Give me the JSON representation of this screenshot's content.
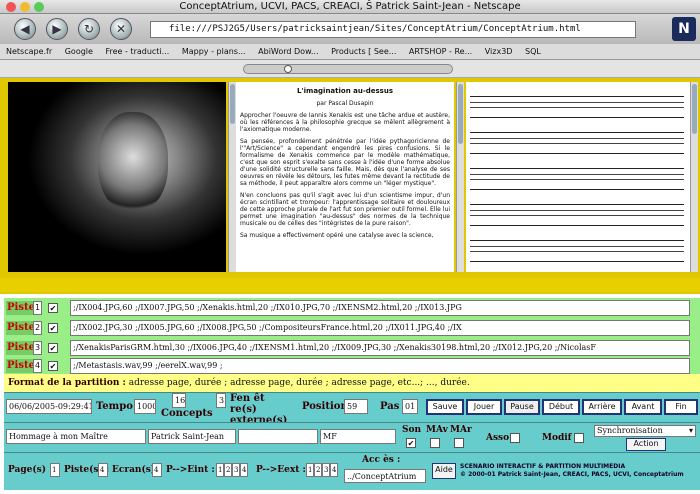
{
  "window": {
    "title": "ConceptAtrium, UCVI, PACS, CREACI, Š Patrick Saint-Jean - Netscape"
  },
  "toolbar": {
    "url": "file:///PSJ2G5/Users/patricksaintjean/Sites/ConceptAtrium/ConceptAtrium.html",
    "nav_icons": [
      "back-icon",
      "forward-icon",
      "reload-icon",
      "stop-icon"
    ],
    "logo": "N"
  },
  "bookmarks": [
    "Netscape.fr",
    "Google",
    "Free - traducti...",
    "Mappy - plans...",
    "AbiWord Dow...",
    "Products [ See...",
    "ARTSHOP - Re...",
    "Vizx3D",
    "SQL"
  ],
  "article": {
    "title": "L'imagination au-dessus",
    "author": "par Pascal Dusapin",
    "paragraphs": [
      "Approcher l'oeuvre de Iannis Xenakis est une tâche ardue et austère, où les références à la philosophie grecque se mêlent allègrement à l'axiomatique moderne.",
      "Sa pensée, profondément pénétrée par l'idée pythagoricienne de l'\"Art/Science\" a cependant engendré les pires confusions. Si le formalisme de Xenakis commence par le modèle mathématique, c'est que son esprit s'exalte sans cesse à l'idée d'une forme absolue d'une solidité structurelle sans faille. Mais, dès que l'analyse de ses oeuvres en révèle les détours, les futes même devant la rectitude de sa méthode, il peut apparaître alors comme un \"léger mystique\".",
      "N'en concluons pas qu'il s'agit avec lui d'un scientisme impur, d'un écran scintillant et trompeur: l'apprentissage solitaire et douloureux de cette approche plurale de l'art fut son premier outil formel. Elle lui permet une imagination \"au-dessus\" des normes de la technique musicale ou de celles des \"intégristes de la pure raison\".",
      "Sa musique a effectivement opéré une catalyse avec la science,"
    ]
  },
  "tracks": [
    {
      "label": "Piste",
      "num": "1",
      "content": ";/IX004.JPG,60                              ;/IX007.JPG,50                              ;/Xenakis.html,20   ;/IX010.JPG,70                                  ;/IXENSM2.html,20   ;/IX013.JPG"
    },
    {
      "label": "Piste",
      "num": "2",
      "content": ";/IX002.JPG,30           ;/IX005.JPG,60                      ;/IX008.JPG,50                      ;/CompositeursFrance.html,20          ;/IX011.JPG,40              ;/IX"
    },
    {
      "label": "Piste",
      "num": "3",
      "content": ";/XenakisParisGRM.html,30    ;/IX006.JPG,40           ;/IXENSM1.html,20   ;/IX009.JPG,30           ;/Xenakis30198.html,20          ;/IX012.JPG,20    ;/NicolasF"
    },
    {
      "label": "Piste",
      "num": "4",
      "content": "                                             ;/Metastasis.wav,99                                                     ;/eerelX.wav,99                                                       ;"
    }
  ],
  "format": {
    "label": "Format de la partition :",
    "value": "adresse page, durée ; adresse page, durée ; adresse page, etc...; ..., durée."
  },
  "controls": {
    "date": "06/06/2005-09:29:41",
    "tempo_label": "Tempo :",
    "tempo_value": "1000",
    "concepts_num": "16",
    "concepts_label": "Concepts",
    "fenetres_num": "3",
    "fenetres_label": "Fen êt re(s) externe(s)",
    "position_label": "Position :",
    "position_value": "59",
    "pas_label": "Pas :",
    "pas_value": "01",
    "buttons": [
      "Sauve",
      "Jouer",
      "Pause",
      "Début",
      "Arrière",
      "Avant",
      "Fin"
    ],
    "title_field": "Hommage à mon Maître",
    "author_field": "Patrick Saint-Jean",
    "empty_field": "",
    "mf_field": "MF",
    "son_label": "Son",
    "son_checked": "✔",
    "mav_label": "MAv",
    "mar_label": "MAr",
    "asso_label": "Asso",
    "modif_label": "Modif",
    "sync_select": "Synchronisation",
    "action_button": "Action",
    "pages_label": "Page(s) :",
    "pages_value": "1",
    "pistes_label": "Piste(s) :",
    "pistes_value": "4",
    "ecrans_label": "Ecran(s) :",
    "ecrans_value": "4",
    "eint_label": "P-->Eint :",
    "eint_boxes": [
      "1",
      "2",
      "3",
      "4"
    ],
    "eext_label": "P-->Eext :",
    "eext_boxes": [
      "1",
      "2",
      "3",
      "4"
    ],
    "acces_label": "Acc ès :",
    "acces_value": "../ConceptAtrium",
    "aide_button": "Aide",
    "footer_line1": "SCENARIO INTERACTIF & PARTITION MULTIMEDIA",
    "footer_line2": "© 2000-01 Patrick Saint-Jean, CREACI, PACS, UCVI, Conceptatrium"
  }
}
